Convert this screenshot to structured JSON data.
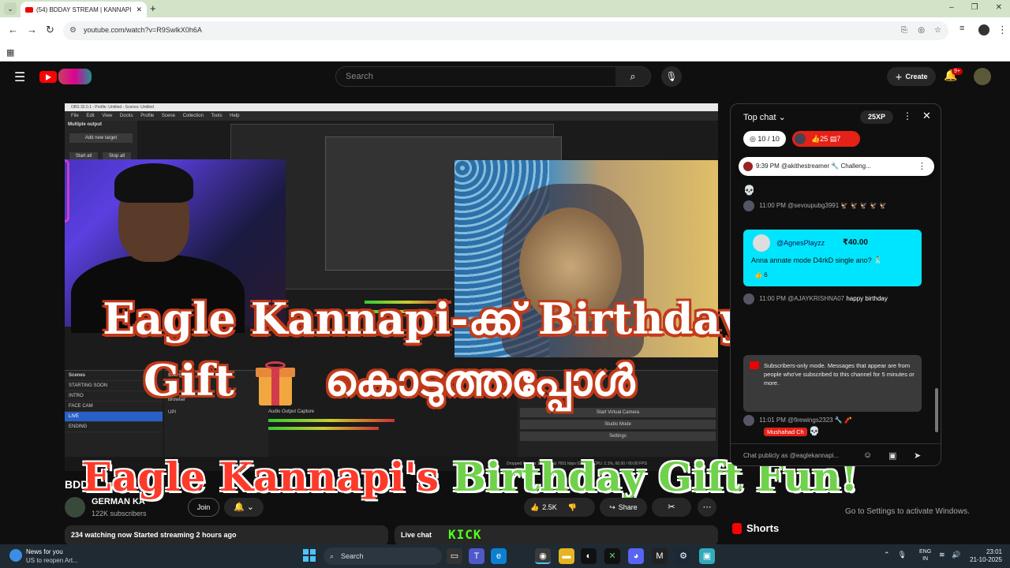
{
  "browser": {
    "tab_title": "(54) BDDAY STREAM | KANNAPI",
    "tab_close": "✕",
    "new_tab": "+",
    "url": "youtube.com/watch?v=R9SwlkX0h6A",
    "win_min": "–",
    "win_max": "❐",
    "win_close": "✕"
  },
  "youtube": {
    "search_placeholder": "Search",
    "create_label": "Create",
    "notif_count": "9+"
  },
  "video": {
    "obs_window_title": "OBS 32.0.1 - Profile: Untitled - Scenes: Untitled",
    "obs_menu": "File Edit View Docks Profile Scene Collection Tools Help",
    "multiple_output": "Multiple output",
    "add_new_target": "Add new target",
    "start_all": "Start all",
    "stop_all": "Stop all",
    "scenes_header": "Scenes",
    "scenes": [
      "STARTING SOON",
      "INTRO",
      "FACE CAM",
      "LIVE",
      "ENDING"
    ],
    "selected_scene": "LIVE",
    "sources_header": "Sources",
    "sources": [
      "Browser",
      "UPI"
    ],
    "audio_capture": "Audio Output Capture",
    "obs_buttons": [
      "Start Virtual Camera",
      "Studio Mode",
      "Settings"
    ],
    "obs_status": "Dropped Frames 147 (5.0%)    7651 kbps    02:48:38    CPU: 2.1%, 60.00 / 60.00 FPS",
    "overlay_line1": "Eagle Kannapi-ക്ക് Birthday",
    "overlay_line2a": "Gift",
    "overlay_line2b": "കൊടുത്തപ്പോൾ",
    "overlay_line3_red": "Eagle Kannapi's",
    "overlay_line3_green": "Birthday Gift Fun!"
  },
  "below_video": {
    "title_partial": "BDD",
    "channel_name": "GERMAN KA",
    "subscribers": "122K subscribers",
    "join_label": "Join",
    "likes": "2.5K",
    "share_label": "Share",
    "watching": "234 watching now  Started streaming 2 hours ago",
    "live_chat_label": "Live chat",
    "kick_label": "KICK",
    "activate_windows": "Go to Settings to activate Windows.",
    "shorts_label": "Shorts"
  },
  "chat": {
    "top_chat_label": "Top chat",
    "xp_label": "25XP",
    "goal": "10 / 10",
    "likes_count": "25",
    "comments_count": "7",
    "pinned_time": "9:39 PM",
    "pinned_user": "@akithestreamer",
    "pinned_text": "Challeng...",
    "messages": [
      {
        "time": "11:00 PM",
        "user": "@sevoupubg3991",
        "text": "🦅 🦅 🦅 🦅 🦅"
      },
      {
        "time": "11:00 PM",
        "user": "@AJAYKRISHNA07",
        "text": "happy birthday"
      },
      {
        "time": "11:01 PM",
        "user": "@firewings2323",
        "text": "🔧 🧨"
      }
    ],
    "superchat_user": "@AgnesPlayzz",
    "superchat_amount": "₹40.00",
    "superchat_text": "Anna annate mode D4rkD single ano? 🕺",
    "superchat_likes": "6",
    "submode_text": "Subscribers-only mode. Messages that appear are from people who've subscribed to this channel for 5 minutes or more.",
    "mushahad_label": "Mushahad Ch",
    "input_placeholder": "Chat publicly as @eaglekannapi..."
  },
  "taskbar": {
    "news_title": "News for you",
    "news_sub": "US to reopen Art...",
    "search_label": "Search",
    "lang_top": "ENG",
    "lang_bottom": "IN",
    "time": "23:01",
    "date": "21-10-2025"
  }
}
